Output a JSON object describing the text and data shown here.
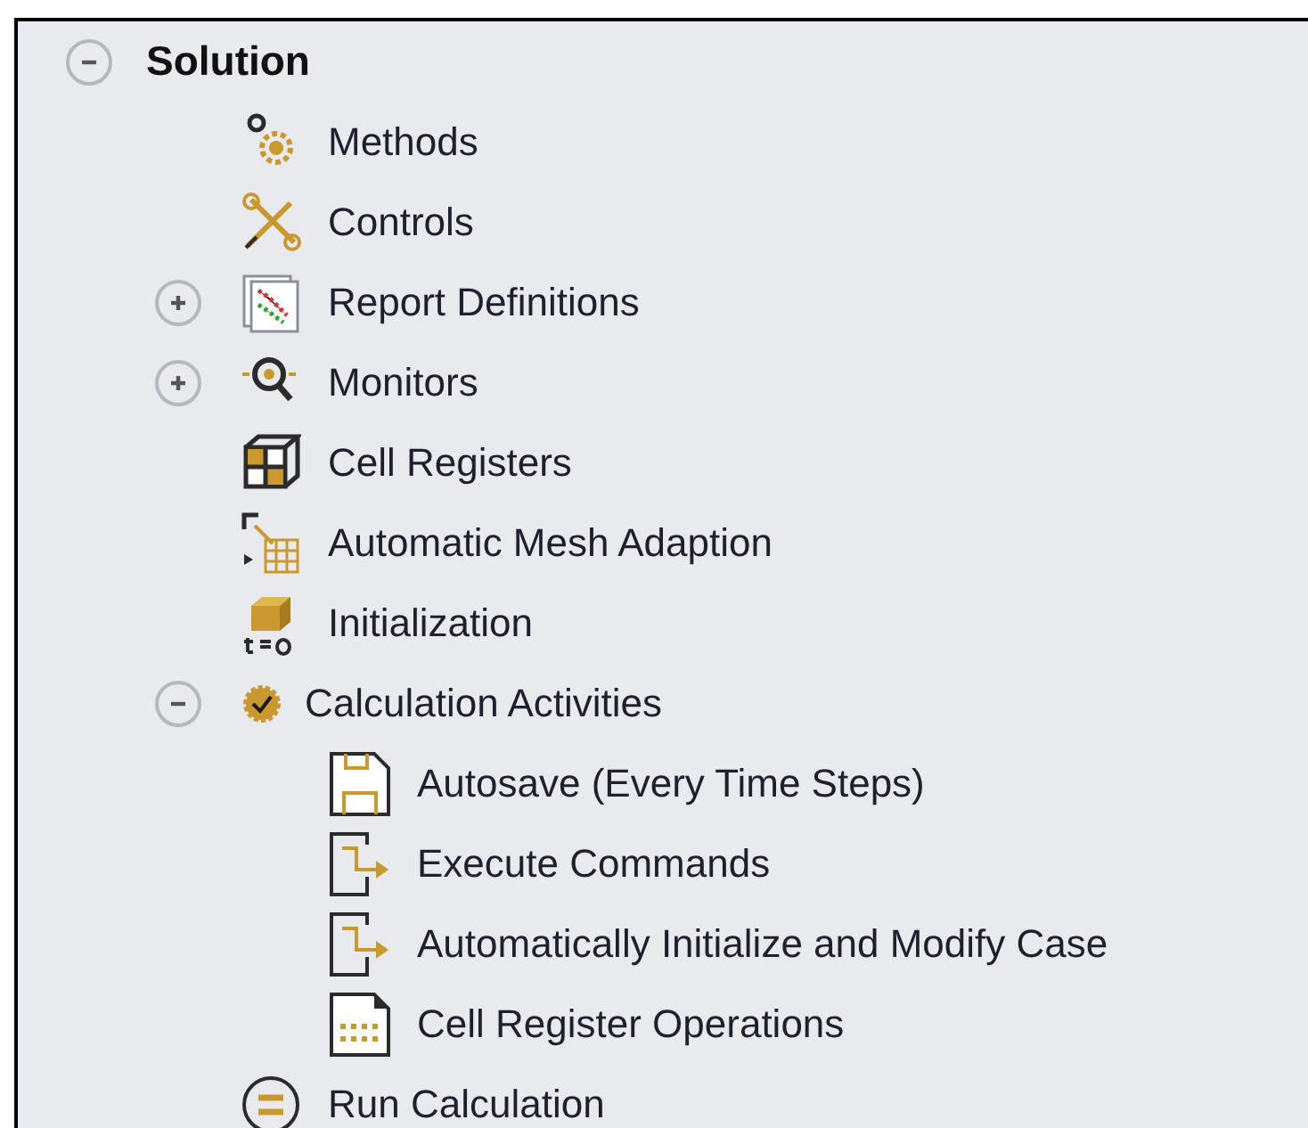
{
  "tree": [
    {
      "label": "Solution",
      "expanded": true,
      "kind": "root",
      "children": [
        {
          "label": "Methods",
          "kind": "methods"
        },
        {
          "label": "Controls",
          "kind": "controls"
        },
        {
          "label": "Report Definitions",
          "kind": "report",
          "expanded": false
        },
        {
          "label": "Monitors",
          "kind": "monitors",
          "expanded": false
        },
        {
          "label": "Cell Registers",
          "kind": "cells"
        },
        {
          "label": "Automatic Mesh Adaption",
          "kind": "mesh"
        },
        {
          "label": "Initialization",
          "kind": "init"
        },
        {
          "label": "Calculation Activities",
          "kind": "activities",
          "expanded": true,
          "children": [
            {
              "label": "Autosave (Every Time Steps)",
              "kind": "save"
            },
            {
              "label": "Execute Commands",
              "kind": "execute"
            },
            {
              "label": "Automatically Initialize and Modify Case",
              "kind": "execute"
            },
            {
              "label": "Cell Register Operations",
              "kind": "cellops"
            }
          ]
        },
        {
          "label": "Run Calculation",
          "kind": "run"
        }
      ]
    }
  ]
}
